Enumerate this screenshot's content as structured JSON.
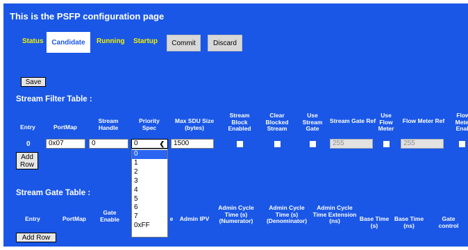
{
  "page": {
    "title": "This is the PSFP configuration page"
  },
  "tabs": [
    {
      "label": "Status"
    },
    {
      "label": "Candidate"
    },
    {
      "label": "Running"
    },
    {
      "label": "Startup"
    }
  ],
  "actions": {
    "commit": "Commit",
    "discard": "Discard",
    "save": "Save"
  },
  "colors": {
    "background": "#1a57e6",
    "link": "#f0f000",
    "button": "#d8d8d8",
    "dropdown_highlight": "#2a66f2"
  },
  "stream_filter": {
    "title": "Stream Filter Table :",
    "headers": [
      "Entry",
      "PortMap",
      "Stream Handle",
      "Priority Spec",
      "Max SDU Size (bytes)",
      "Stream Block Enabled",
      "Clear Blocked Stream",
      "Use Stream Gate",
      "Stream Gate Ref",
      "Use Flow Meter",
      "Flow Meter Ref",
      "Flow Meter Enab"
    ],
    "row": {
      "entry": "0",
      "portmap": "0x07",
      "stream_handle": "0",
      "priority_spec": "0",
      "max_sdu": "1500",
      "stream_gate_ref": "255",
      "flow_meter_ref": "255"
    },
    "add_row": "Add Row",
    "priority_options": [
      "0",
      "1",
      "2",
      "3",
      "4",
      "5",
      "6",
      "7",
      "0xFF"
    ]
  },
  "stream_gate": {
    "title": "Stream Gate Table :",
    "headers": [
      "Entry",
      "PortMap",
      "Gate Enable",
      "e",
      "Admin IPV",
      "Admin Cycle Time (s) (Numerator)",
      "Admin Cycle Time (s) (Denominator)",
      "Admin Cycle Time Extension (ns)",
      "Base Time (s)",
      "Base Time (ns)",
      "Gate control"
    ],
    "add_row": "Add Row"
  },
  "icons": {
    "dropdown": "chevron-down-icon",
    "checkbox": "checkbox"
  }
}
